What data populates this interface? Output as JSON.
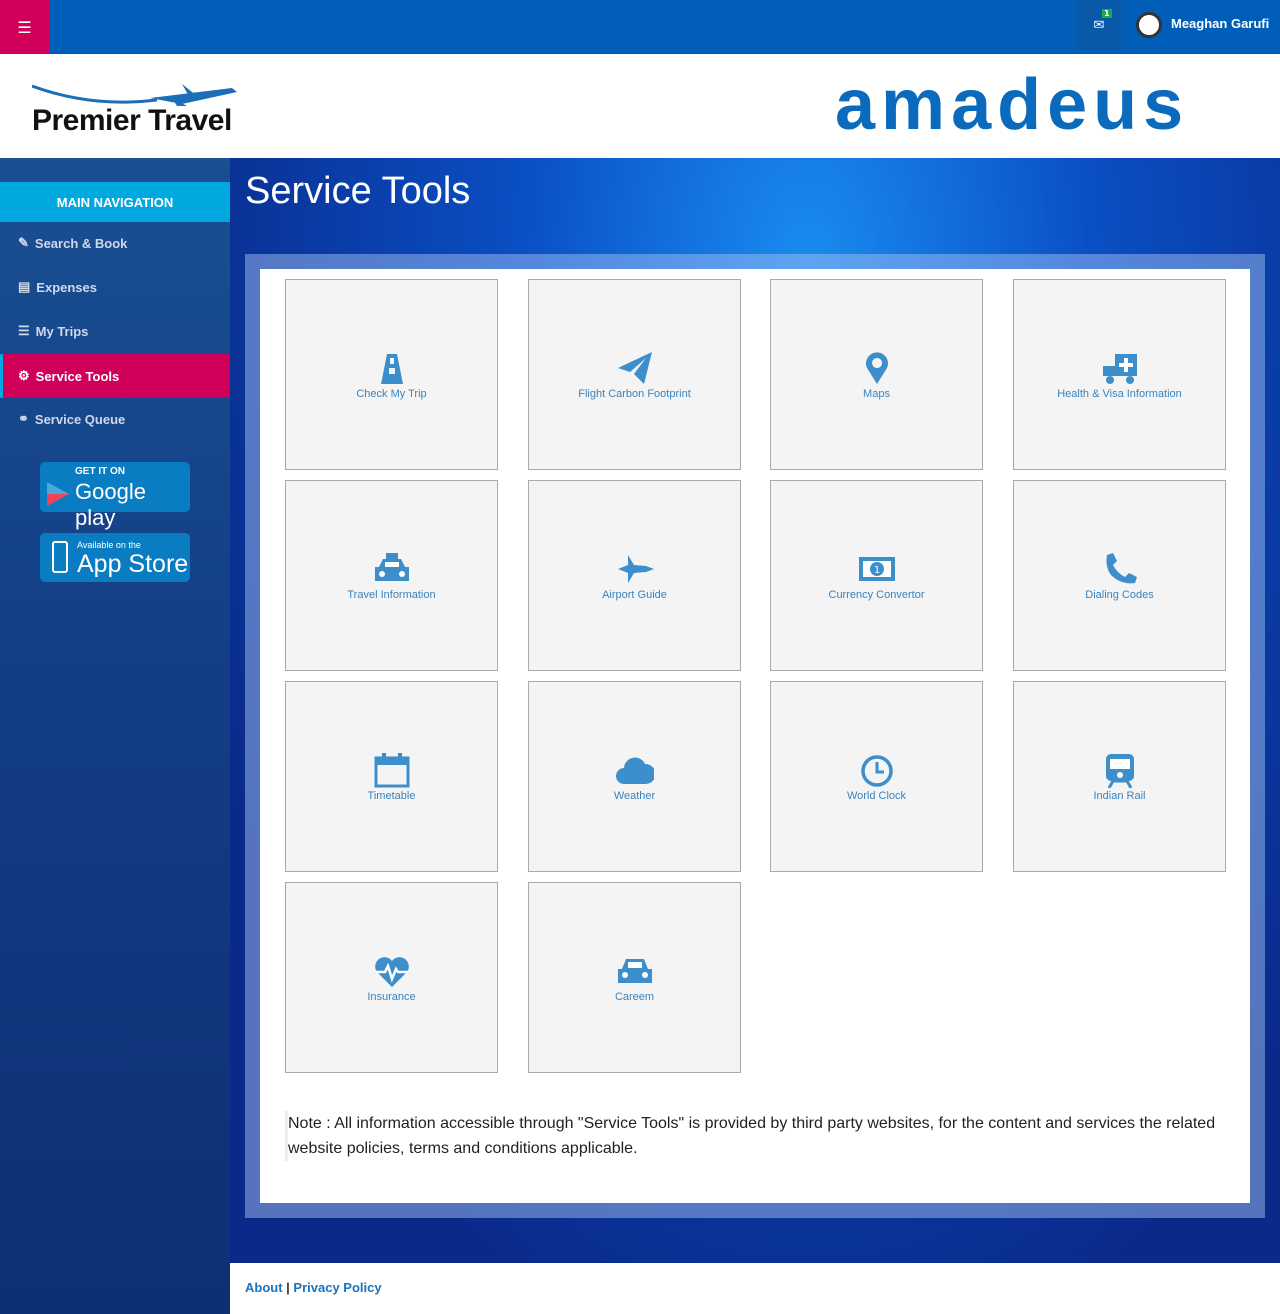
{
  "topbar": {
    "menu_icon": "hamburger-icon",
    "mail_badge": "1",
    "user_name": "Meaghan Garufi"
  },
  "header": {
    "brand": "Premier Travel",
    "partner": "amadeus"
  },
  "sidebar": {
    "heading": "MAIN NAVIGATION",
    "items": [
      {
        "label": "Search & Book",
        "icon": "edit-icon"
      },
      {
        "label": "Expenses",
        "icon": "money-icon"
      },
      {
        "label": "My Trips",
        "icon": "list-icon"
      },
      {
        "label": "Service Tools",
        "icon": "cogs-icon",
        "active": true
      },
      {
        "label": "Service Queue",
        "icon": "handshake-icon"
      }
    ],
    "google_play": {
      "small": "GET IT ON",
      "big": "Google play"
    },
    "app_store": {
      "small": "Available on the",
      "big": "App Store"
    }
  },
  "main": {
    "title": "Service Tools",
    "tiles": [
      {
        "label": "Check My Trip",
        "icon": "road-icon"
      },
      {
        "label": "Flight Carbon Footprint",
        "icon": "paper-plane-icon"
      },
      {
        "label": "Maps",
        "icon": "map-marker-icon"
      },
      {
        "label": "Health & Visa Information",
        "icon": "ambulance-icon"
      },
      {
        "label": "Travel Information",
        "icon": "taxi-icon"
      },
      {
        "label": "Airport Guide",
        "icon": "fighter-jet-icon"
      },
      {
        "label": "Currency Convertor",
        "icon": "money-icon"
      },
      {
        "label": "Dialing Codes",
        "icon": "phone-icon"
      },
      {
        "label": "Timetable",
        "icon": "calendar-icon"
      },
      {
        "label": "Weather",
        "icon": "cloud-icon"
      },
      {
        "label": "World Clock",
        "icon": "clock-icon"
      },
      {
        "label": "Indian Rail",
        "icon": "train-icon"
      },
      {
        "label": "Insurance",
        "icon": "heartbeat-icon"
      },
      {
        "label": "Careem",
        "icon": "car-icon"
      }
    ],
    "note": "Note : All information accessible through \"Service Tools\" is provided by third party websites, for the content and services the related website policies, terms and conditions applicable."
  },
  "footer": {
    "about": "About",
    "separator": " | ",
    "privacy": "Privacy Policy"
  },
  "colors": {
    "topbar": "#005eb8",
    "accent": "#d0005a",
    "nav_heading": "#00a8e0",
    "tile_text": "#3a83bd"
  }
}
